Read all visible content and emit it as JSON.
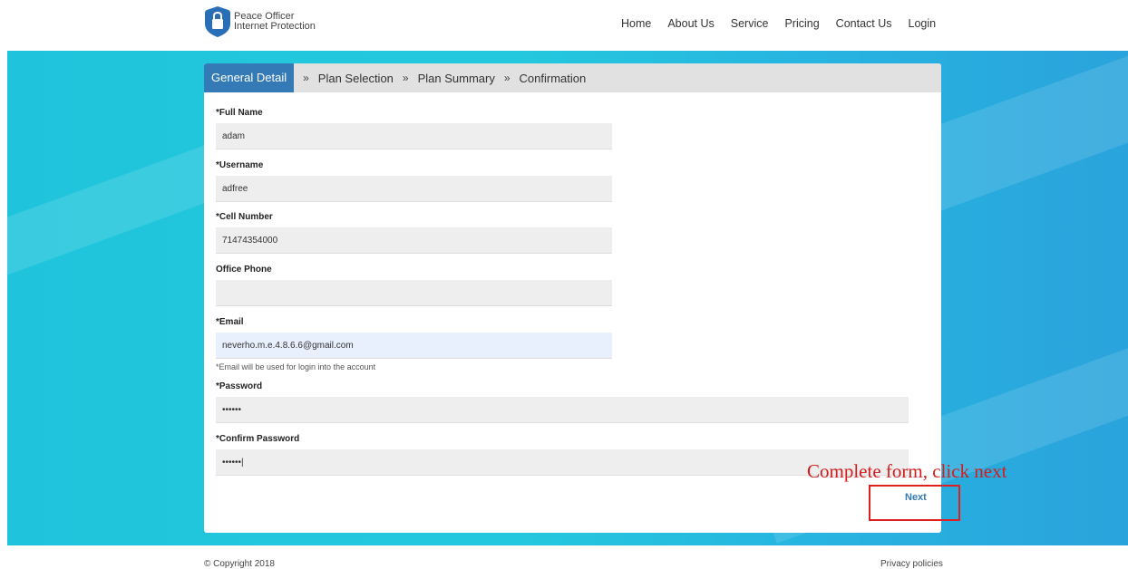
{
  "logo": {
    "line1": "Peace Officer",
    "line2": "Internet Protection"
  },
  "nav": [
    "Home",
    "About Us",
    "Service",
    "Pricing",
    "Contact Us",
    "Login"
  ],
  "steps": {
    "active": "General Detail",
    "items": [
      "Plan Selection",
      "Plan Summary",
      "Confirmation"
    ],
    "separator": "»"
  },
  "form": {
    "full_name": {
      "label": "*Full Name",
      "value": "adam"
    },
    "username": {
      "label": "*Username",
      "value": "adfree"
    },
    "cell_number": {
      "label": "*Cell Number",
      "value": "71474354000"
    },
    "office_phone": {
      "label": "Office Phone",
      "value": ""
    },
    "email": {
      "label": "*Email",
      "value": "neverho.m.e.4.8.6.6@gmail.com",
      "hint": "*Email will be used for login into the account"
    },
    "password": {
      "label": "*Password",
      "value": "••••••"
    },
    "confirm_password": {
      "label": "*Confirm Password",
      "value": "••••••|"
    },
    "next_label": "Next"
  },
  "annotation": {
    "text": "Complete form, click next"
  },
  "footer": {
    "copyright": "© Copyright 2018",
    "privacy": "Privacy policies"
  },
  "colors": {
    "accent": "#337ab7",
    "hero": "#1fc4dc",
    "annotation": "#d41c1c"
  }
}
